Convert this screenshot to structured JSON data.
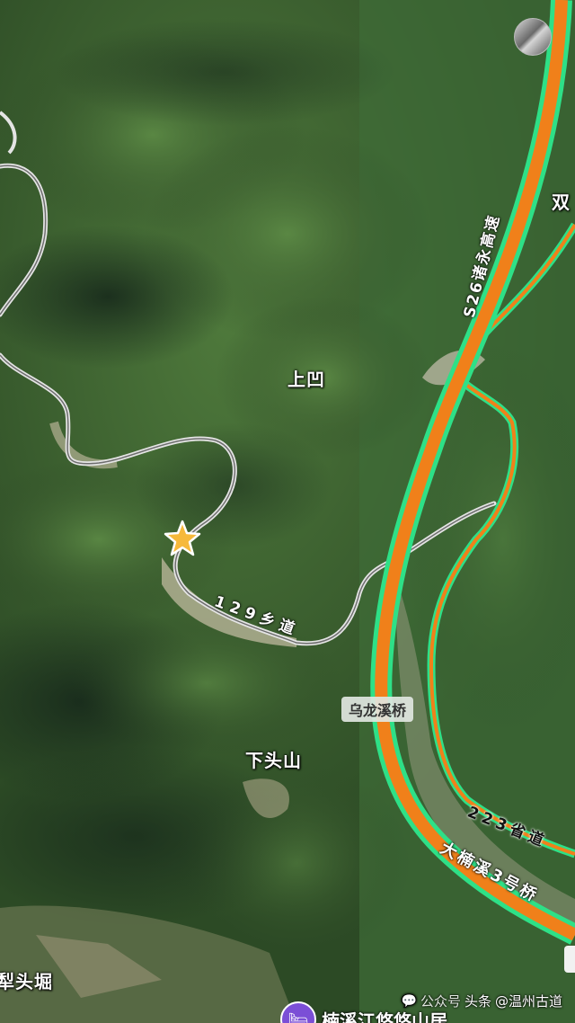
{
  "places": {
    "shangao": "上凹",
    "xiatoushan": "下头山",
    "litoujue": "犁头堀",
    "shuang": "双"
  },
  "roads": {
    "s26": "S26诸永高速",
    "xiangdao": "129乡道",
    "shengdao": "223省道",
    "nanxi_bridge3": "大楠溪3号桥"
  },
  "bridge_label": "乌龙溪桥",
  "poi": {
    "label": "楠溪江悠悠山居",
    "icon": "bed-icon"
  },
  "watermark": {
    "prefix": "公众号",
    "source": "头条",
    "handle": "@温州古道"
  },
  "marker": {
    "icon": "star-icon",
    "color": "#f6b93b"
  },
  "colors": {
    "expressway": "#f0801a",
    "expressway_casing": "#2ee087",
    "provincial_road": "#f0801a",
    "local_road": "#d9d9d9",
    "terrain": "#355a2c"
  }
}
